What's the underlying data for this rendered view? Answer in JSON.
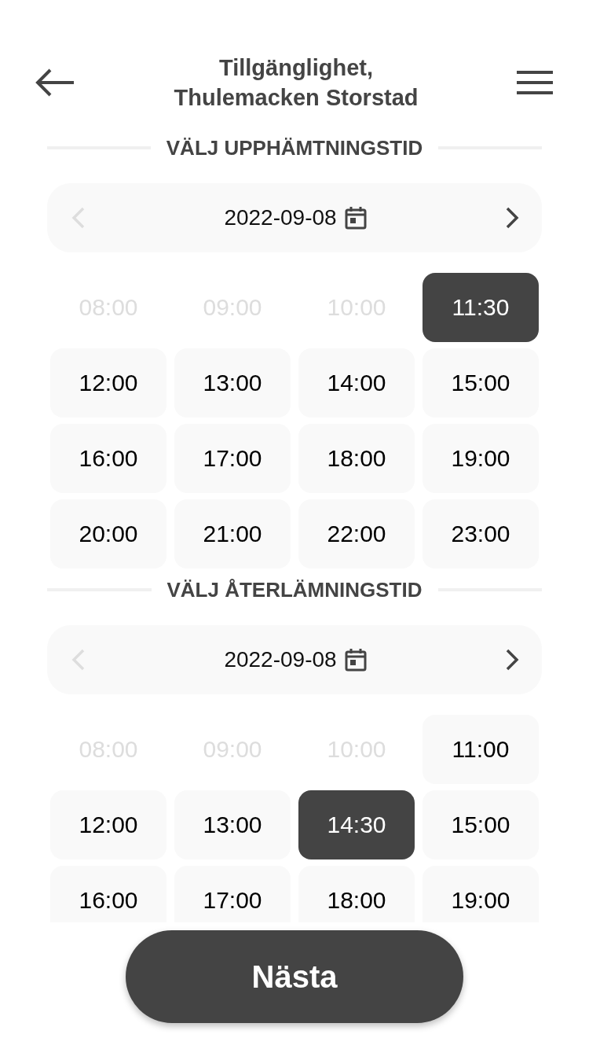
{
  "header": {
    "title_lines": [
      "Tillgänglighet,",
      "Thulemacken Storstad"
    ]
  },
  "sections": [
    {
      "heading": "VÄLJ UPPHÄMTNINGSTID",
      "date": "2022-09-08",
      "prev_disabled": true,
      "slots": [
        {
          "time": "08:00",
          "disabled": true,
          "selected": false
        },
        {
          "time": "09:00",
          "disabled": true,
          "selected": false
        },
        {
          "time": "10:00",
          "disabled": true,
          "selected": false
        },
        {
          "time": "11:30",
          "disabled": false,
          "selected": true
        },
        {
          "time": "12:00",
          "disabled": false,
          "selected": false
        },
        {
          "time": "13:00",
          "disabled": false,
          "selected": false
        },
        {
          "time": "14:00",
          "disabled": false,
          "selected": false
        },
        {
          "time": "15:00",
          "disabled": false,
          "selected": false
        },
        {
          "time": "16:00",
          "disabled": false,
          "selected": false
        },
        {
          "time": "17:00",
          "disabled": false,
          "selected": false
        },
        {
          "time": "18:00",
          "disabled": false,
          "selected": false
        },
        {
          "time": "19:00",
          "disabled": false,
          "selected": false
        },
        {
          "time": "20:00",
          "disabled": false,
          "selected": false
        },
        {
          "time": "21:00",
          "disabled": false,
          "selected": false
        },
        {
          "time": "22:00",
          "disabled": false,
          "selected": false
        },
        {
          "time": "23:00",
          "disabled": false,
          "selected": false
        }
      ]
    },
    {
      "heading": "VÄLJ ÅTERLÄMNINGSTID",
      "date": "2022-09-08",
      "prev_disabled": true,
      "slots": [
        {
          "time": "08:00",
          "disabled": true,
          "selected": false
        },
        {
          "time": "09:00",
          "disabled": true,
          "selected": false
        },
        {
          "time": "10:00",
          "disabled": true,
          "selected": false
        },
        {
          "time": "11:00",
          "disabled": false,
          "selected": false
        },
        {
          "time": "12:00",
          "disabled": false,
          "selected": false
        },
        {
          "time": "13:00",
          "disabled": false,
          "selected": false
        },
        {
          "time": "14:30",
          "disabled": false,
          "selected": true
        },
        {
          "time": "15:00",
          "disabled": false,
          "selected": false
        },
        {
          "time": "16:00",
          "disabled": false,
          "selected": false
        },
        {
          "time": "17:00",
          "disabled": false,
          "selected": false
        },
        {
          "time": "18:00",
          "disabled": false,
          "selected": false
        },
        {
          "time": "19:00",
          "disabled": false,
          "selected": false
        }
      ]
    }
  ],
  "next_button": {
    "label": "Nästa"
  }
}
